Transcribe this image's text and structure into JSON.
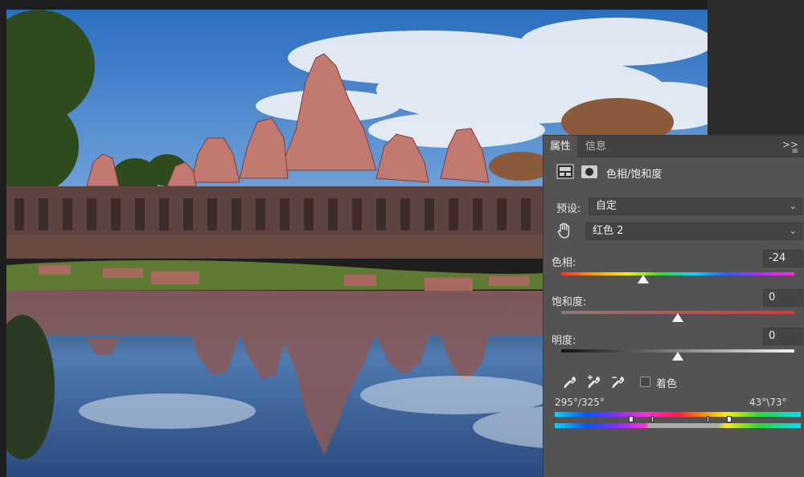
{
  "photo": {
    "sky_colors": [
      "#2a73c6",
      "#5f9ad8"
    ],
    "temple_color": "#c07a70",
    "subject": "temple"
  },
  "panel": {
    "tabs": [
      {
        "label": "属性",
        "active": true
      },
      {
        "label": "信息",
        "active": false
      }
    ],
    "menu_glyph": ">>",
    "menu_lines": "≡",
    "adjustment_title": "色相/饱和度",
    "preset": {
      "label": "预设:",
      "value": "自定"
    },
    "channel": {
      "value": "红色 2"
    },
    "hue": {
      "label": "色相:",
      "value": "-24",
      "level_fraction": 0.35
    },
    "saturation": {
      "label": "饱和度:",
      "value": "0",
      "level_fraction": 0.5
    },
    "lightness": {
      "label": "明度:",
      "value": "0",
      "level_fraction": 0.5
    },
    "colorize": {
      "label": "着色",
      "checked": false
    },
    "range": {
      "left": "295°/325°",
      "right": "43°\\73°"
    },
    "icons": {
      "layer_icon": "adjustment-layer-icon",
      "mask_icon": "mask-icon",
      "hand_icon": "targeted-adjust-hand-icon",
      "eyedropper": "eyedropper-icon",
      "eyedropper_plus": "eyedropper-add-icon",
      "eyedropper_minus": "eyedropper-subtract-icon"
    }
  }
}
